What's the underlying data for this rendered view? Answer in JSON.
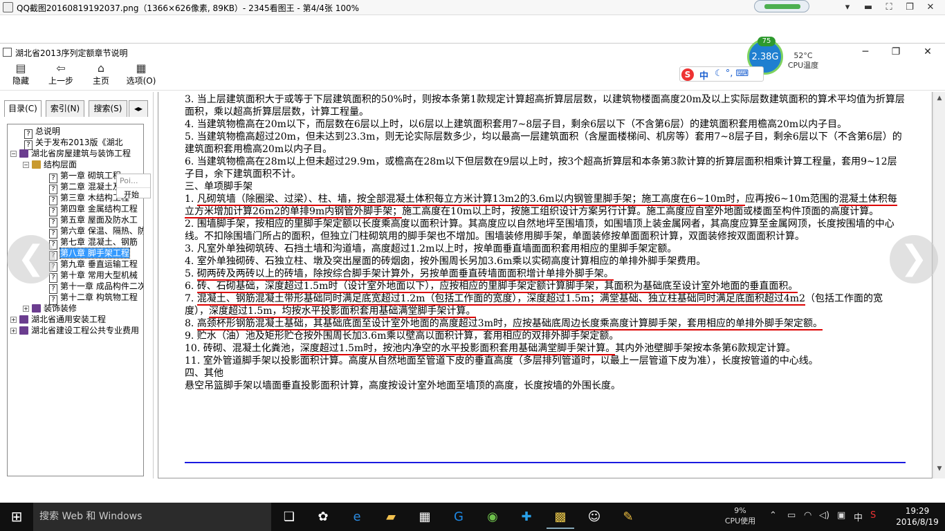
{
  "viewer": {
    "title": "QQ截图20160819192037.png（1366×626像素, 89KB）- 2345看图王 - 第4/4张 100%",
    "controls": [
      "▾",
      "▬",
      "⛶",
      "❐",
      "✕"
    ]
  },
  "helpwin": {
    "title": "湖北省2013序列定额章节说明",
    "controls": [
      "─",
      "❐",
      "✕"
    ],
    "toolbar": [
      {
        "icon": "hide-icon",
        "glyph": "▤",
        "label": "隐藏"
      },
      {
        "icon": "back-arrow-icon",
        "glyph": "⇦",
        "label": "上一步"
      },
      {
        "icon": "home-icon",
        "glyph": "⌂",
        "label": "主页"
      },
      {
        "icon": "options-icon",
        "glyph": "▦",
        "label": "选项(O)"
      }
    ],
    "tabs": [
      "目录(C)",
      "索引(N)",
      "搜索(S)"
    ],
    "tree": [
      {
        "label": "总说明",
        "icon": "help-page-icon",
        "level": 2
      },
      {
        "label": "关于发布2013版《湖北",
        "icon": "help-page-icon",
        "level": 2
      },
      {
        "label": "湖北省房屋建筑与装饰工程",
        "icon": "book-icon",
        "level": 1,
        "toggle": "−"
      },
      {
        "label": "结构层面",
        "icon": "book-open-icon",
        "level": 2,
        "toggle": "−"
      },
      {
        "label": "第一章 砌筑工程",
        "icon": "help-page-icon",
        "level": 3
      },
      {
        "label": "第二章 混凝土及钢筋",
        "icon": "help-page-icon",
        "level": 3
      },
      {
        "label": "第三章 木结构工程",
        "icon": "help-page-icon",
        "level": 3
      },
      {
        "label": "第四章 金属结构工程",
        "icon": "help-page-icon",
        "level": 3
      },
      {
        "label": "第五章 屋面及防水工",
        "icon": "help-page-icon",
        "level": 3
      },
      {
        "label": "第六章 保温、隔热、防",
        "icon": "help-page-icon",
        "level": 3
      },
      {
        "label": "第七章 混凝土、钢筋",
        "icon": "help-page-icon",
        "level": 3
      },
      {
        "label": "第八章 脚手架工程",
        "icon": "help-page-icon",
        "level": 3,
        "selected": true
      },
      {
        "label": "第九章 垂直运输工程",
        "icon": "help-page-icon",
        "level": 3
      },
      {
        "label": "第十章 常用大型机械",
        "icon": "help-page-icon",
        "level": 3
      },
      {
        "label": "第十一章 成品构件二次",
        "icon": "help-page-icon",
        "level": 3
      },
      {
        "label": "第十二章 构筑物工程",
        "icon": "help-page-icon",
        "level": 3
      },
      {
        "label": "装饰装修",
        "icon": "book-icon",
        "level": 2,
        "toggle": "+"
      },
      {
        "label": "湖北省通用安装工程",
        "icon": "book-icon",
        "level": 1,
        "toggle": "+"
      },
      {
        "label": "湖北省建设工程公共专业费用",
        "icon": "book-icon",
        "level": 1,
        "toggle": "+"
      }
    ],
    "popup": {
      "item1": "Poi...",
      "item2": "开始"
    }
  },
  "content": {
    "paragraphs": [
      {
        "segs": [
          {
            "t": "3. 当上层建筑面积大于或等于下层建筑面积的50%时，则按本条第1款规定计算超高折算层层数，以建筑物楼面高度20m及以上实际层数建筑面积的算术平均值为折算层面积，乘以超高折算层层数，计算工程量。"
          }
        ]
      },
      {
        "segs": [
          {
            "t": "4. 当建筑物檐高在20m以下，而层数在6层以上时，以6层以上建筑面积套用7~8层子目，剩余6层以下（不含第6层）的建筑面积套用檐高20m以内子目。"
          }
        ]
      },
      {
        "segs": [
          {
            "t": "5. 当建筑物檐高超过20m，但未达到23.3m，则无论实际层数多少，均以最高一层建筑面积（含屋面楼梯间、机房等）套用7~8层子目，剩余6层以下（不含第6层）的建筑面积套用檐高20m以内子目。"
          }
        ]
      },
      {
        "segs": [
          {
            "t": "6. 当建筑物檐高在28m以上但未超过29.9m，或檐高在28m以下但层数在9层以上时，按3个超高折算层和本条第3款计算的折算层面积相乘计算工程量，套用9~12层子目，余下建筑面积不计。"
          }
        ]
      },
      {
        "segs": [
          {
            "t": "三、单项脚手架"
          }
        ]
      },
      {
        "segs": [
          {
            "t": "1. "
          },
          {
            "t": "凡砌筑墙（除圈梁、过梁）、柱、墙，按全部混凝土体积每立方米计算13m2的3.6m以内钢管里脚手架；施工高度在6~10m时，",
            "u": true
          },
          {
            "t": "应再按6~10m范围的"
          },
          {
            "t": "混凝土体积每立方米增加计算26m2的单排9m内钢管外脚手架；",
            "u": true
          },
          {
            "t": "施工高度在10m以上时，按施工组织设计方案另行计算。施工高度应自室外地面或楼面至构件顶面的高度计算。"
          }
        ]
      },
      {
        "segs": [
          {
            "t": "2. 围墙脚手架，按相应的里脚手架定额以长度乘高度以面积计算。其高度应以自然地坪至围墙顶，如围墙顶上装金属网者，其高度应算至金属网顶，长度按围墙的中心线。不扣除围墙门所占的面积，但独立门柱砌筑用的脚手架也不增加。围墙装修用脚手架，单面装修按单面面积计算，双面装修按双面面积计算。"
          }
        ]
      },
      {
        "segs": [
          {
            "t": "3. 凡室外单独砌筑砖、石挡土墙和沟道墙，高度超过1.2m以上时，按单面垂直墙面面积套用相应的里脚手架定额。"
          }
        ]
      },
      {
        "segs": [
          {
            "t": "4. 室外单独砌砖、石独立柱、墩及突出屋面的砖烟囱，按外围周长另加3.6m乘以实砌高度计算相应的单排外脚手架费用。"
          }
        ]
      },
      {
        "segs": [
          {
            "t": "5. "
          },
          {
            "t": "砌两砖及两砖以上的砖墙，除按综合脚手架计算外，另按单面垂直砖墙面面积增计单排外脚手架。",
            "u": true
          }
        ]
      },
      {
        "segs": [
          {
            "t": "6. "
          },
          {
            "t": "砖、石砌基础，深度超过1.5m时（设计室外地面以下），应按相应的里脚手架定额计算脚手架，其面积为基础底至设计室外地面的垂直面积。",
            "u": true
          }
        ]
      },
      {
        "segs": [
          {
            "t": "7. "
          },
          {
            "t": "混凝土、钢筋混凝土带形基础同时满足底宽超过1.2m（包括工作面的宽度），深度超过1.5m；满堂基础、独立柱基础同时满足底面积超过4m2",
            "u": true
          },
          {
            "t": "（包括工作面的宽度），"
          },
          {
            "t": "深度超过1.5m，均按水平投影面积套用基础满堂脚手架计算。",
            "u": true
          }
        ]
      },
      {
        "segs": [
          {
            "t": "8. "
          },
          {
            "t": "高颈杯形钢筋混凝土基础，其基础底面至设计室外地面的高度超过3m时，应按基础底周边长度乘高度计算脚手架，套用相应的单排外脚手架定额。",
            "u": true
          }
        ]
      },
      {
        "segs": [
          {
            "t": "9. 贮水（油）池及矩形贮仓按外围周长加3.6m乘以壁高以面积计算，套用相应的双排外脚手架定额。"
          }
        ]
      },
      {
        "segs": [
          {
            "t": "10. 砖砌、混凝土化粪池，"
          },
          {
            "t": "深度超过1.5m时，按池内净空的水平投影面积套用基础满堂脚手架计算。",
            "u": true
          },
          {
            "t": "其内外池壁脚手架按本条第6款规定计算。"
          }
        ]
      },
      {
        "segs": [
          {
            "t": "11. 室外管道脚手架以投影面积计算。高度从自然地面至管道下皮的垂直高度（多层排列管道时，以最上一层管道下皮为准），长度按管道的中心线。"
          }
        ]
      },
      {
        "segs": [
          {
            "t": "四、其他"
          }
        ]
      },
      {
        "segs": [
          {
            "t": "悬空吊篮脚手架以墙面垂直投影面积计算，高度按设计室外地面至墙顶的高度，长度按墙的外围长度。"
          }
        ]
      }
    ]
  },
  "overlay": {
    "gauge_percent": "75",
    "gauge_value": "2.38G",
    "cpu_temp_value": "52°C",
    "cpu_temp_label": "CPU温度",
    "ime_lang": "中",
    "ime_logo": "S"
  },
  "taskbar": {
    "search_placeholder": "搜索 Web 和 Windows",
    "apps": [
      "task-view-icon",
      "app-icon",
      "edge-icon",
      "file-explorer-icon",
      "store-icon",
      "browser-g-icon",
      "green-app-icon",
      "blue-app-icon",
      "image-viewer-icon",
      "contact-icon",
      "notes-icon"
    ],
    "cpu_percent": "9%",
    "cpu_label": "CPU使用",
    "ime": "中",
    "time": "19:29",
    "date": "2016/8/19"
  }
}
